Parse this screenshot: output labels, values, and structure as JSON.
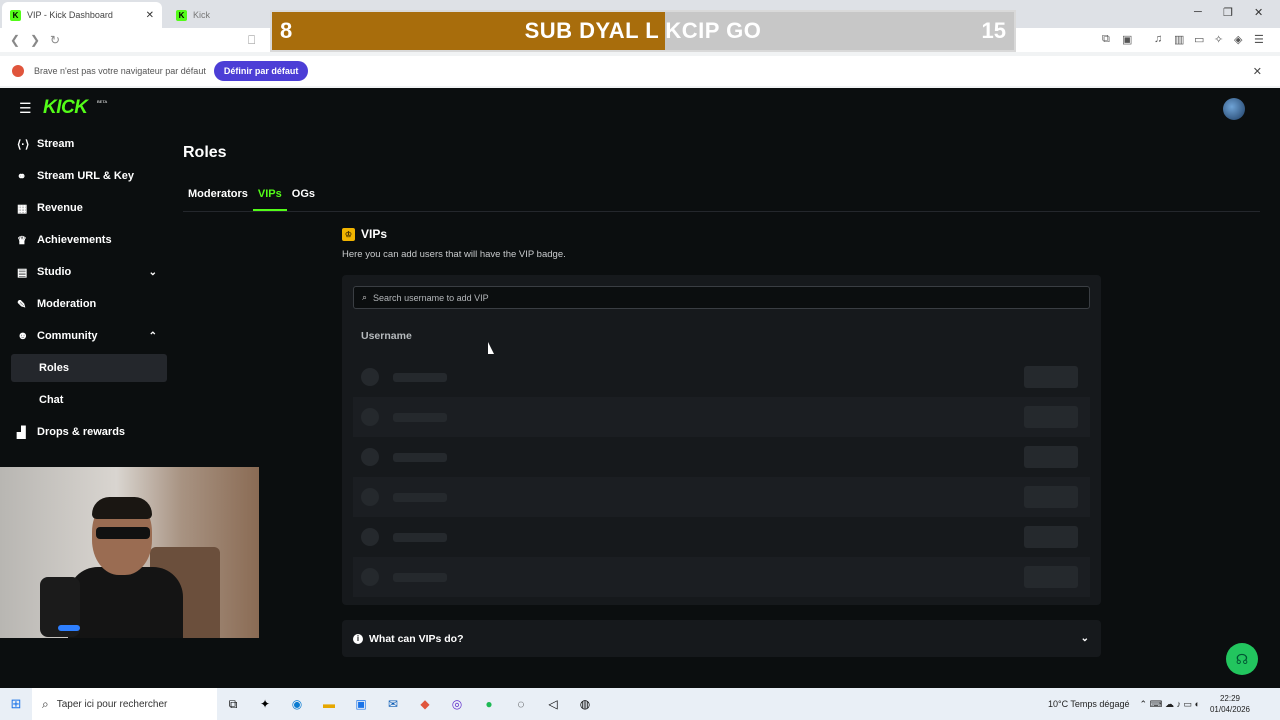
{
  "browser": {
    "tabs": [
      {
        "title": "VIP - Kick Dashboard",
        "favicon": "K"
      },
      {
        "title": "Kick",
        "favicon": "K"
      }
    ],
    "infobar": {
      "message": "Brave n'est pas votre navigateur par défaut",
      "button": "Définir par défaut"
    }
  },
  "overlay": {
    "left_number": "8",
    "text": "SUB DYAL L KCIP GO",
    "right_number": "15",
    "progress": 0.53
  },
  "app": {
    "logo": "KICK",
    "beta": "BETA",
    "sidebar": {
      "items": [
        {
          "label": "Stream",
          "icon": "broadcast-icon"
        },
        {
          "label": "Stream URL & Key",
          "icon": "link-icon"
        },
        {
          "label": "Revenue",
          "icon": "chart-icon"
        },
        {
          "label": "Achievements",
          "icon": "trophy-icon"
        },
        {
          "label": "Studio",
          "icon": "studio-icon"
        },
        {
          "label": "Moderation",
          "icon": "wrench-icon"
        },
        {
          "label": "Community",
          "icon": "users-icon"
        },
        {
          "label": "Roles",
          "icon": ""
        },
        {
          "label": "Chat",
          "icon": ""
        },
        {
          "label": "Drops & rewards",
          "icon": "drops-icon"
        }
      ]
    },
    "page_title": "Roles",
    "tabs": [
      "Moderators",
      "VIPs",
      "OGs"
    ],
    "active_tab": "VIPs",
    "section": {
      "title": "VIPs",
      "description": "Here you can add users that will have the VIP badge.",
      "search_placeholder": "Search username to add VIP",
      "column_header": "Username",
      "loading_rows": 6
    },
    "faq": {
      "label": "What can VIPs do?"
    }
  },
  "taskbar": {
    "search_placeholder": "Taper ici pour rechercher",
    "weather": "10°C  Temps dégagé",
    "time": "22:29",
    "date": "01/04/2026"
  },
  "colors": {
    "accent": "#53fc18",
    "background": "#0b0e0f",
    "panel": "#16191c",
    "overlay_fill": "#a86d0c"
  }
}
